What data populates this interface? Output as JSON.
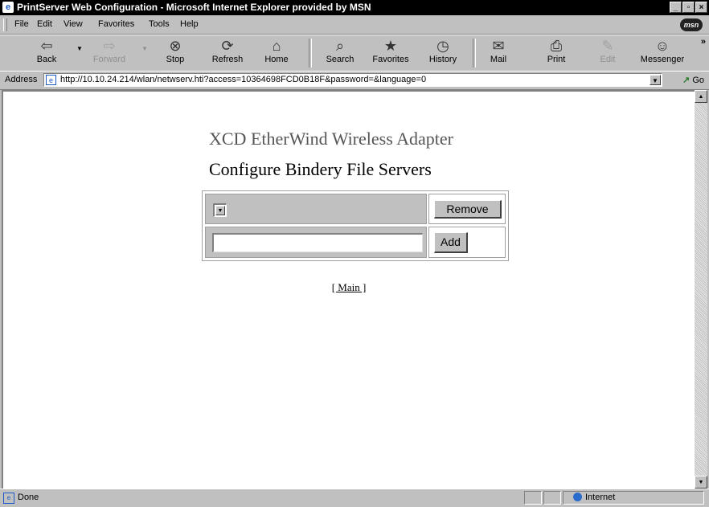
{
  "window": {
    "title": "PrintServer Web Configuration - Microsoft Internet Explorer provided by MSN",
    "controls": [
      "_",
      "▫",
      "×"
    ]
  },
  "menubar": {
    "items": [
      "File",
      "Edit",
      "View",
      "Favorites",
      "Tools",
      "Help"
    ],
    "logo": "msn"
  },
  "toolbar": {
    "back": "Back",
    "forward": "Forward",
    "stop": "Stop",
    "refresh": "Refresh",
    "home": "Home",
    "search": "Search",
    "favorites": "Favorites",
    "history": "History",
    "mail": "Mail",
    "print": "Print",
    "edit": "Edit",
    "messenger": "Messenger",
    "more": "»"
  },
  "addressbar": {
    "label": "Address",
    "url": "http://10.10.24.214/wlan/netwserv.hti?access=10364698FCD0B18F&password=&language=0",
    "go": "Go"
  },
  "page": {
    "heading": "XCD EtherWind Wireless Adapter",
    "subheading": "Configure Bindery File Servers",
    "server_select_value": "",
    "remove_button": "Remove",
    "new_server_value": "",
    "add_button": "Add",
    "main_link": "[ Main ]"
  },
  "statusbar": {
    "status": "Done",
    "zone": "Internet"
  }
}
